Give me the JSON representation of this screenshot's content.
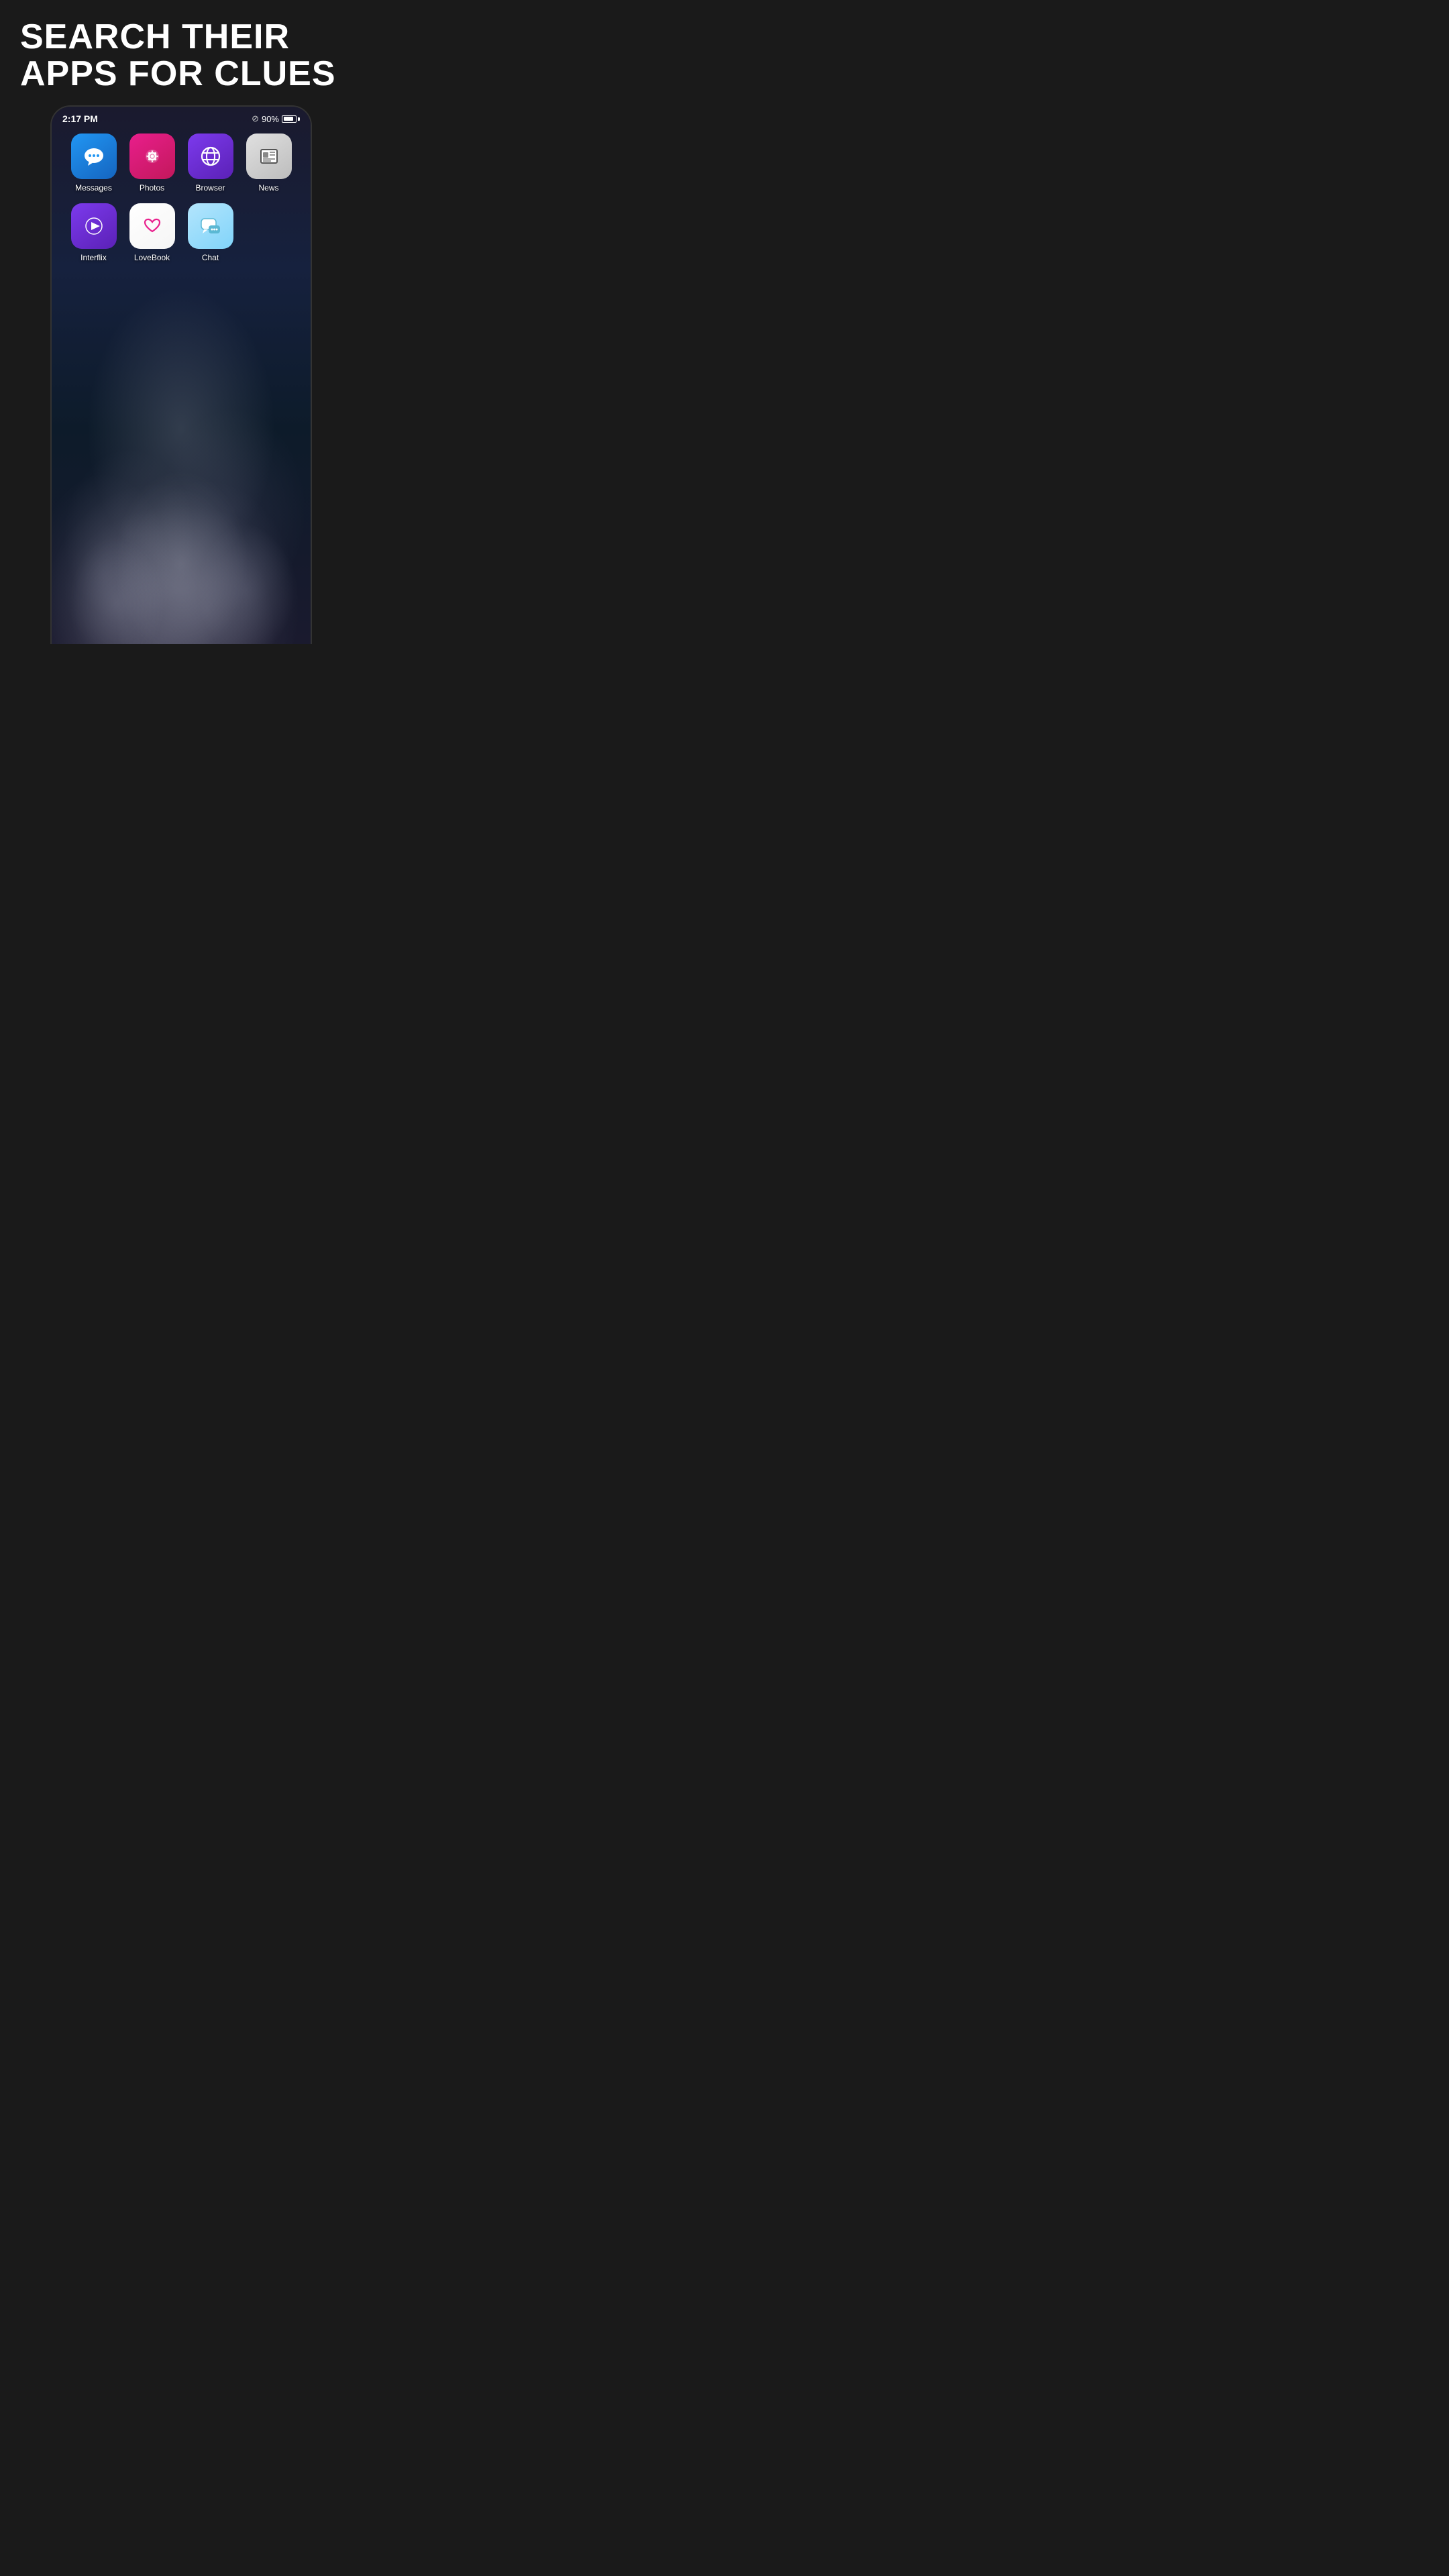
{
  "headline": {
    "line1": "SEARCH THEIR",
    "line2": "APPS FOR CLUES"
  },
  "status_bar": {
    "time": "2:17 PM",
    "battery_percent": "90%"
  },
  "apps_row1": [
    {
      "id": "messages",
      "label": "Messages",
      "icon_type": "messages"
    },
    {
      "id": "photos",
      "label": "Photos",
      "icon_type": "photos"
    },
    {
      "id": "browser",
      "label": "Browser",
      "icon_type": "browser"
    },
    {
      "id": "news",
      "label": "News",
      "icon_type": "news"
    }
  ],
  "apps_row2": [
    {
      "id": "interflix",
      "label": "Interflix",
      "icon_type": "interflix"
    },
    {
      "id": "lovebook",
      "label": "LoveBook",
      "icon_type": "lovebook"
    },
    {
      "id": "chat",
      "label": "Chat",
      "icon_type": "chat"
    },
    {
      "id": "empty",
      "label": "",
      "icon_type": "empty"
    }
  ]
}
